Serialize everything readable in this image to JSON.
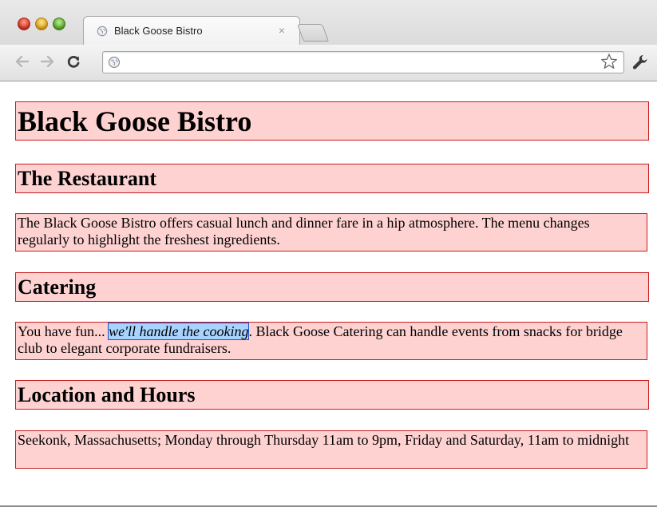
{
  "browser": {
    "tab_title": "Black Goose Bistro",
    "tab_close_glyph": "×",
    "address_value": "",
    "icons": {
      "back": "arrow-left-icon",
      "forward": "arrow-right-icon",
      "reload": "reload-icon",
      "globe": "globe-icon",
      "bookmark": "star-icon",
      "settings": "wrench-icon"
    },
    "window_controls": {
      "close": "#d8321f",
      "minimize": "#e0a31a",
      "zoom": "#5aa82a"
    }
  },
  "page": {
    "title": "Black Goose Bistro",
    "sections": [
      {
        "heading": "The Restaurant",
        "paragraph": "The Black Goose Bistro offers casual lunch and dinner fare in a hip atmosphere. The menu changes regularly to highlight the freshest ingredients."
      },
      {
        "heading": "Catering",
        "paragraph_before": "You have fun... ",
        "emphasis": "we'll handle the cooking",
        "paragraph_after": ". Black Goose Catering can handle events from snacks for bridge club to elegant corporate fundraisers."
      },
      {
        "heading": "Location and Hours",
        "paragraph": "Seekonk, Massachusetts; Monday through Thursday 11am to 9pm, Friday and Saturday, 11am to midnight"
      }
    ]
  },
  "colors": {
    "block_background": "#ffd2d2",
    "block_border": "#c81c1c",
    "emphasis_background": "#a7d3ff",
    "emphasis_border": "#1a4fd1"
  }
}
